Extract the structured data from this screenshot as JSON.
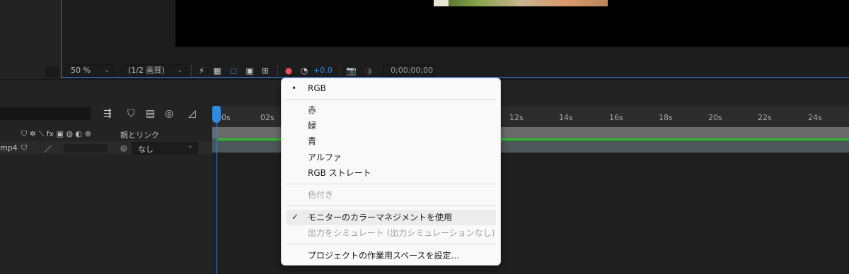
{
  "viewer": {
    "magnification": "50 %",
    "resolution": "(1/2 画質)",
    "exposure": "+0.0",
    "timecode": "0;00;00;00"
  },
  "timeline": {
    "parent_header": "親とリンク",
    "layer_name_fragment": "mp4",
    "parent_value": "なし",
    "ruler_labels": [
      "00s",
      "02s",
      "12s",
      "14s",
      "16s",
      "18s",
      "20s",
      "22s",
      "24s"
    ]
  },
  "channel_menu": {
    "items": [
      {
        "label": "RGB",
        "mark": "•"
      },
      {
        "label": "赤"
      },
      {
        "label": "緑"
      },
      {
        "label": "青"
      },
      {
        "label": "アルファ"
      },
      {
        "label": "RGB ストレート"
      },
      {
        "label": "色付き",
        "disabled": true
      },
      {
        "label": "モニターのカラーマネジメントを使用",
        "mark": "✓"
      },
      {
        "label": "出力をシミュレート (出力シミュレーションなし)",
        "disabled": true
      },
      {
        "label": "プロジェクトの作業用スペースを設定..."
      }
    ]
  },
  "colors": {
    "accent_blue": "#2f8ae0",
    "exposure_blue": "#2d8ceb",
    "layer_green": "#2bbd2b"
  }
}
